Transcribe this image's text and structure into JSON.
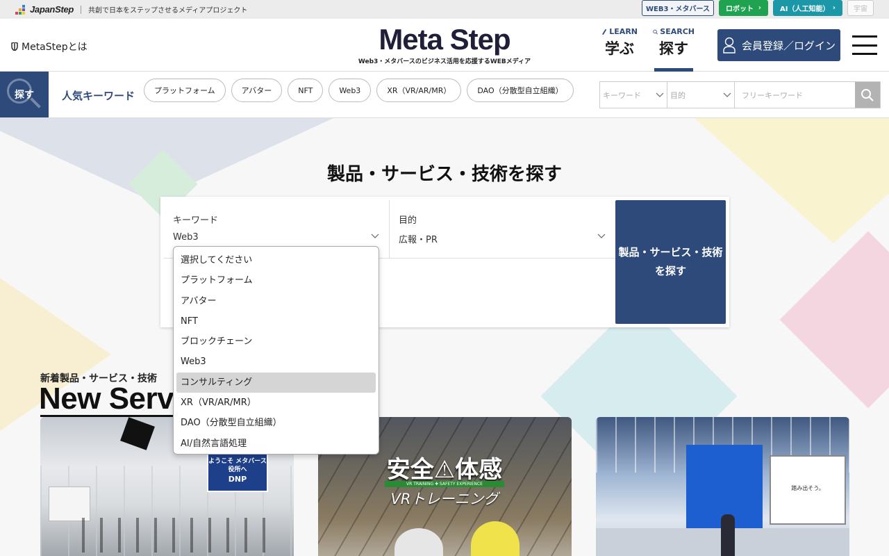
{
  "topbar": {
    "logo_text": "JapanStep",
    "tagline": "共創で日本をステップさせるメディアプロジェクト",
    "links": [
      {
        "label": "WEB3・メタバース"
      },
      {
        "label": "ロボット"
      },
      {
        "label": "AI（人工知能）"
      },
      {
        "label": "宇宙"
      }
    ]
  },
  "header": {
    "about_label": "MetaStepとは",
    "brand": "Meta Step",
    "brand_sub": "Web3・メタバースのビジネス活用を応援するWEBメディア",
    "nav": [
      {
        "en": "LEARN",
        "ja": "学ぶ"
      },
      {
        "en": "SEARCH",
        "ja": "探す"
      }
    ],
    "login_label": "会員登録／ログイン"
  },
  "keyword_bar": {
    "search_label": "探す",
    "popular_label": "人気キーワード",
    "chips": [
      "プラットフォーム",
      "アバター",
      "NFT",
      "Web3",
      "XR（VR/AR/MR）",
      "DAO（分散型自立組織）"
    ],
    "keyword_placeholder": "キーワード",
    "purpose_placeholder": "目的",
    "free_placeholder": "フリーキーワード"
  },
  "hero": {
    "title": "製品・サービス・技術を探す",
    "keyword_label": "キーワード",
    "keyword_value": "Web3",
    "purpose_label": "目的",
    "purpose_value": "広報・PR",
    "submit_label": "製品・サービス・技術を探す"
  },
  "dropdown": {
    "options": [
      "選択してください",
      "プラットフォーム",
      "アバター",
      "NFT",
      "ブロックチェーン",
      "Web3",
      "コンサルティング",
      "XR（VR/AR/MR）",
      "DAO（分散型自立組織）",
      "AI/自然言語処理"
    ],
    "highlighted": "コンサルティング"
  },
  "new_services": {
    "subtitle": "新着製品・サービス・技術",
    "title": "New Servi"
  },
  "thumbnails": [
    {
      "sign": "ようこそ メタバース役所へ",
      "logo": "DNP"
    },
    {
      "headline": "安全⚠体感",
      "band": "VR TRAINING ✚ SAFETY EXPERIENCE",
      "caption": "VRトレーニング"
    },
    {
      "screen_text": "踏み出そう。"
    }
  ],
  "colors": {
    "brand_navy": "#2d4a7a",
    "robot_green": "#1fa351",
    "ai_teal": "#1b97a7"
  }
}
